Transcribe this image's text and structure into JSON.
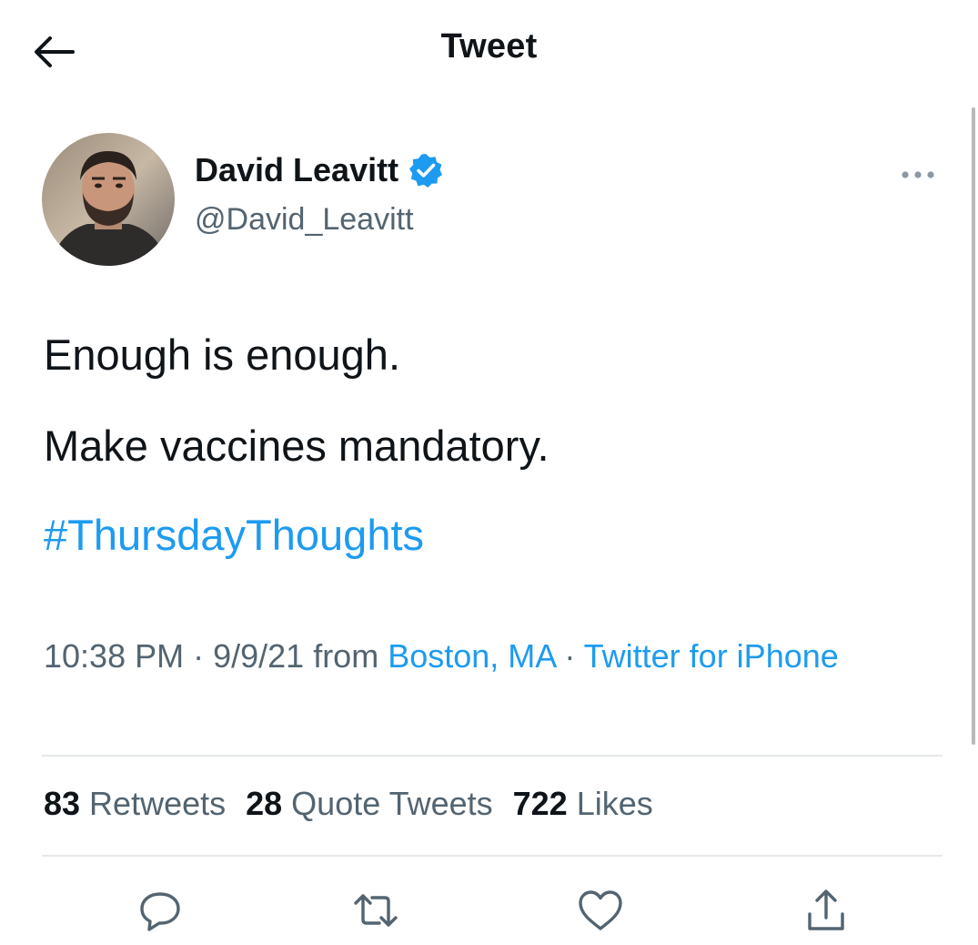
{
  "header": {
    "title": "Tweet"
  },
  "author": {
    "name": "David Leavitt",
    "handle": "@David_Leavitt",
    "verified": true
  },
  "tweet": {
    "line1": "Enough is enough.",
    "line2": "Make vaccines mandatory.",
    "hashtag": "#ThursdayThoughts"
  },
  "meta": {
    "time": "10:38 PM",
    "sep1": " · ",
    "date": "9/9/21",
    "from": " from ",
    "location": "Boston, MA",
    "sep2": " · ",
    "source": "Twitter for iPhone"
  },
  "stats": {
    "retweets_count": "83",
    "retweets_label": "Retweets",
    "quotes_count": "28",
    "quotes_label": "Quote Tweets",
    "likes_count": "722",
    "likes_label": "Likes"
  },
  "icons": {
    "back": "arrow-left-icon",
    "verified": "verified-badge-icon",
    "more": "more-horizontal-icon",
    "reply": "reply-icon",
    "retweet": "retweet-icon",
    "like": "heart-icon",
    "share": "share-icon"
  },
  "colors": {
    "accent": "#1d9bf0",
    "text": "#0f1419",
    "secondary": "#536471",
    "divider": "#e6e9ea"
  }
}
